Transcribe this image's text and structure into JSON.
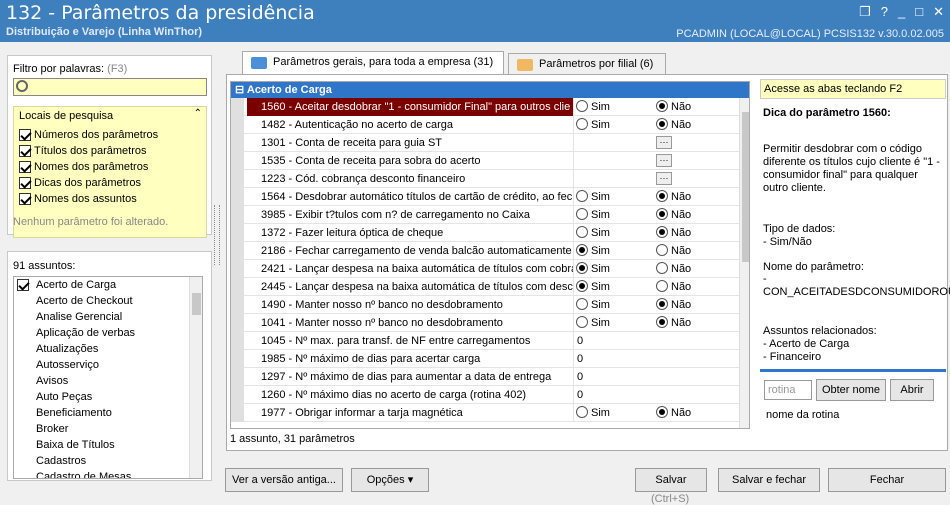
{
  "window": {
    "title": "132 - Parâmetros da presidência",
    "subtitle": "Distribuição e Varejo (Linha WinThor)",
    "info": "PCADMIN (LOCAL@LOCAL)   PCSIS132  v.30.0.02.005"
  },
  "filter": {
    "label": "Filtro por palavras:",
    "shortcut": "(F3)",
    "value": "",
    "locais_title": "Locais de pesquisa",
    "locais": [
      "Números dos parâmetros",
      "Títulos dos parâmetros",
      "Nomes dos parâmetros",
      "Dicas dos parâmetros",
      "Nomes dos assuntos"
    ],
    "nochange": "Nenhum parâmetro foi alterado."
  },
  "subjects": {
    "count": "91 assuntos:",
    "items": [
      "Acerto de Carga",
      "Acerto de Checkout",
      "Analise Gerencial",
      "Aplicação de verbas",
      "Atualizações",
      "Autosserviço",
      "Avisos",
      "Auto Peças",
      "Beneficiamento",
      "Broker",
      "Baixa de Títulos",
      "Cadastros",
      "Cadastro de Mesas"
    ]
  },
  "tabs": [
    {
      "label": "Parâmetros gerais, para toda a empresa (31)"
    },
    {
      "label": "Parâmetros por filial  (6)"
    }
  ],
  "grid": {
    "group": "Acerto de Carga",
    "rows": [
      {
        "label": "1560 - Aceitar desdobrar \"1 - consumidor Final\" para outros clie",
        "type": "radio",
        "value": "Não"
      },
      {
        "label": "1482 - Autenticação no acerto de carga",
        "type": "radio",
        "value": "Não"
      },
      {
        "label": "1301 - Conta de receita para guia ST",
        "type": "ellipsis"
      },
      {
        "label": "1535 - Conta de receita para sobra do acerto",
        "type": "ellipsis"
      },
      {
        "label": "1223 - Cód. cobrança desconto financeiro",
        "type": "ellipsis"
      },
      {
        "label": "1564 - Desdobrar automático títulos de cartão de crédito, ao fec",
        "type": "radio",
        "value": "Não"
      },
      {
        "label": "3985 - Exibir t?tulos com n? de carregamento no Caixa",
        "type": "radio",
        "value": "Não"
      },
      {
        "label": "1372 - Fazer leitura óptica de cheque",
        "type": "radio",
        "value": "Não"
      },
      {
        "label": "2186 - Fechar carregamento de venda balcão automaticamente",
        "type": "radio",
        "value": "Sim"
      },
      {
        "label": "2421 - Lançar despesa na baixa automática de títulos com cobra",
        "type": "radio",
        "value": "Sim"
      },
      {
        "label": "2445 - Lançar despesa na baixa automática de títulos com desco",
        "type": "radio",
        "value": "Sim"
      },
      {
        "label": "1490 - Manter nosso nº banco no desdobramento",
        "type": "radio",
        "value": "Não"
      },
      {
        "label": "1041 - Manter nosso nº banco no desdobramento",
        "type": "radio",
        "value": "Não"
      },
      {
        "label": "1045 - Nº max. para transf. de NF entre carregamentos",
        "type": "text",
        "value": "0"
      },
      {
        "label": "1985 - Nº máximo de dias para acertar carga",
        "type": "text",
        "value": "0"
      },
      {
        "label": "1297 - Nº máximo de dias para aumentar a data de entrega",
        "type": "text",
        "value": "0"
      },
      {
        "label": "1260 - Nº máximo dias no acerto de carga (rotina 402)",
        "type": "text",
        "value": "0"
      },
      {
        "label": "1977 - Obrigar informar a tarja magnética",
        "type": "radio",
        "value": "Não"
      }
    ],
    "sim": "Sim",
    "nao": "Não",
    "status": "1 assunto, 31 parâmetros"
  },
  "right": {
    "hint": "Acesse as abas teclando F2",
    "title": "Dica do parâmetro 1560:",
    "desc": "Permitir desdobrar com o código diferente os títulos cujo cliente é \"1 - consumidor final\" para qualquer outro cliente.",
    "tipo_label": "Tipo de dados:",
    "tipo": " - Sim/Não",
    "nome_label": "Nome do parâmetro:",
    "nome_dash": " -",
    "nome": "CON_ACEITADESDCONSUMIDOROUT",
    "assuntos_label": "Assuntos relacionados:",
    "assuntos": [
      " - Acerto de Carga",
      " - Financeiro"
    ],
    "rotina_ph": "rotina",
    "obter": "Obter nome",
    "abrir": "Abrir",
    "nome_rotina": "nome da rotina"
  },
  "footer": {
    "versao": "Ver a versão antiga...",
    "opcoes": "Opções",
    "salvar": "Salvar",
    "salvar_shortcut": "(Ctrl+S)",
    "salvar_fechar": "Salvar e fechar",
    "fechar": "Fechar"
  }
}
